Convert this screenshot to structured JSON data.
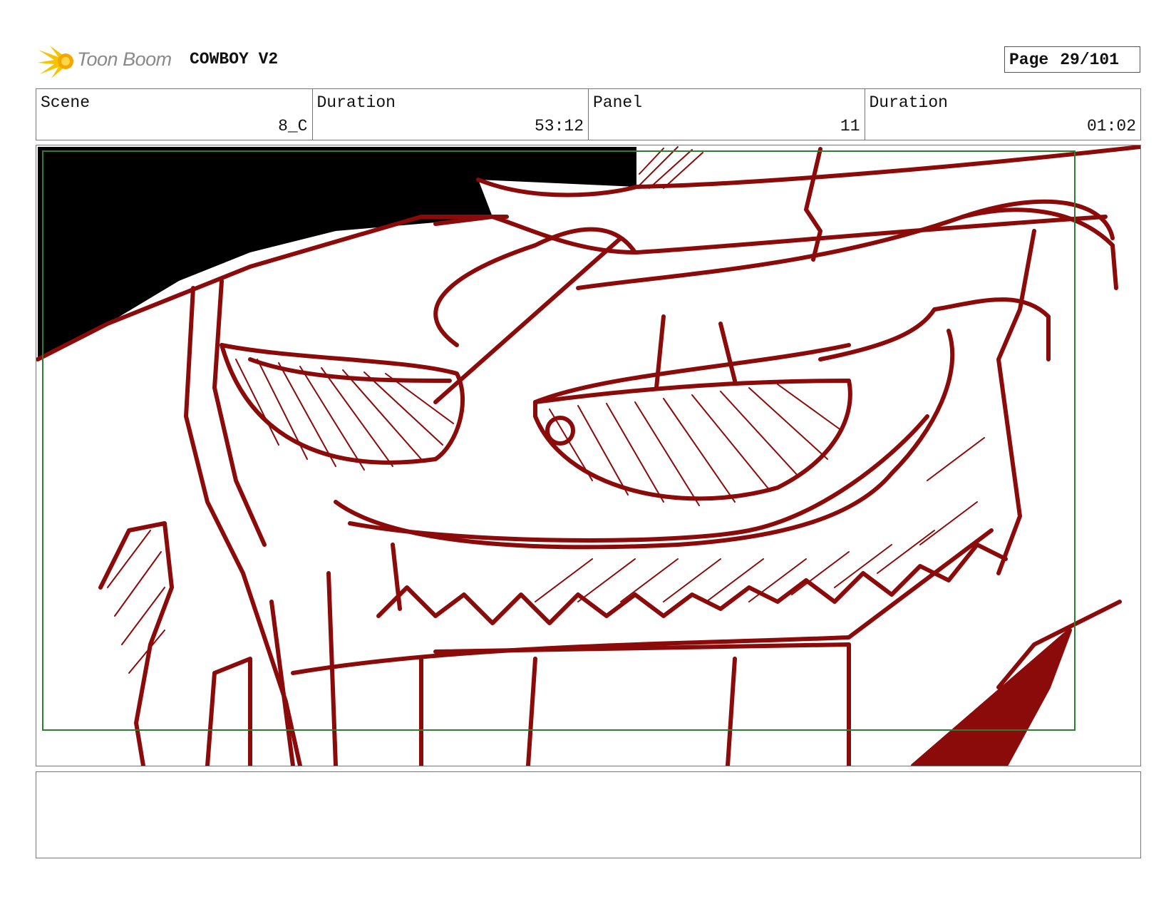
{
  "header": {
    "logo_text": "Toon Boom",
    "project_title": "COWBOY V2",
    "page_label": "Page",
    "page_value": "29/101"
  },
  "info": [
    {
      "label": "Scene",
      "value": "8_C"
    },
    {
      "label": "Duration",
      "value": "53:12"
    },
    {
      "label": "Panel",
      "value": "11"
    },
    {
      "label": "Duration",
      "value": "01:02"
    }
  ],
  "panel": {
    "sketch_color": "#8b0a0a",
    "safe_frame_color": "#2e7d32"
  },
  "notes": {
    "text": ""
  }
}
